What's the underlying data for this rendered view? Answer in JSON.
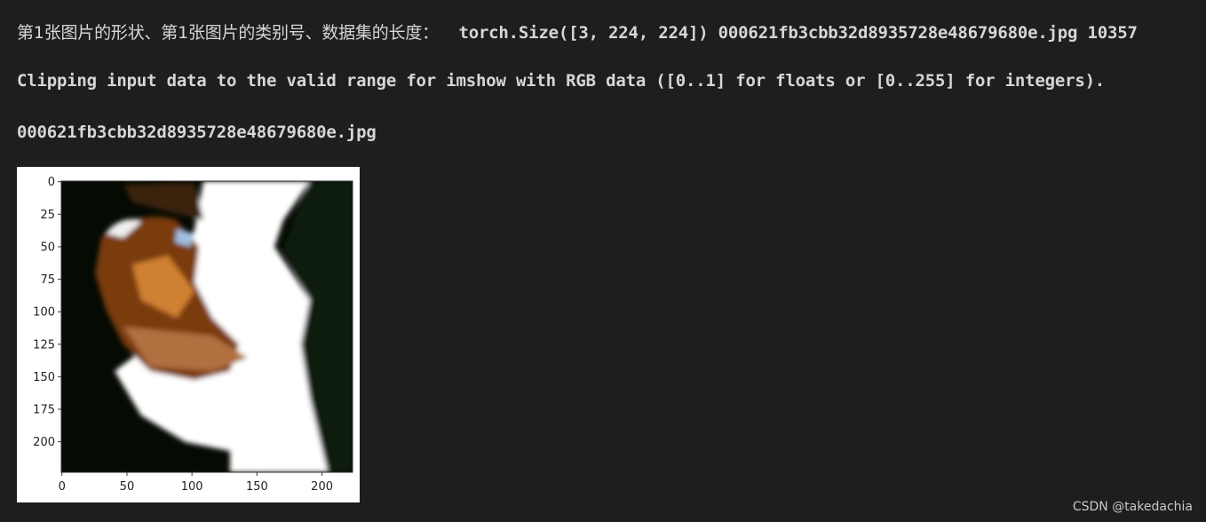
{
  "output": {
    "line1_label": "第1张图片的形状、第1张图片的类别号、数据集的长度：",
    "line1_value": "  torch.Size([3, 224, 224]) 000621fb3cbb32d8935728e48679680e.jpg 10357",
    "line2": "Clipping input data to the valid range for imshow with RGB data ([0..1] for floats or [0..255] for integers).",
    "line3": "000621fb3cbb32d8935728e48679680e.jpg"
  },
  "figure": {
    "image_description_icon": "dog-image",
    "x_ticks": [
      "0",
      "50",
      "100",
      "150",
      "200"
    ],
    "y_ticks": [
      "0",
      "25",
      "50",
      "75",
      "100",
      "125",
      "150",
      "175",
      "200"
    ],
    "xlim": [
      0,
      224
    ],
    "ylim": [
      224,
      0
    ]
  },
  "watermark": "CSDN @takedachia"
}
